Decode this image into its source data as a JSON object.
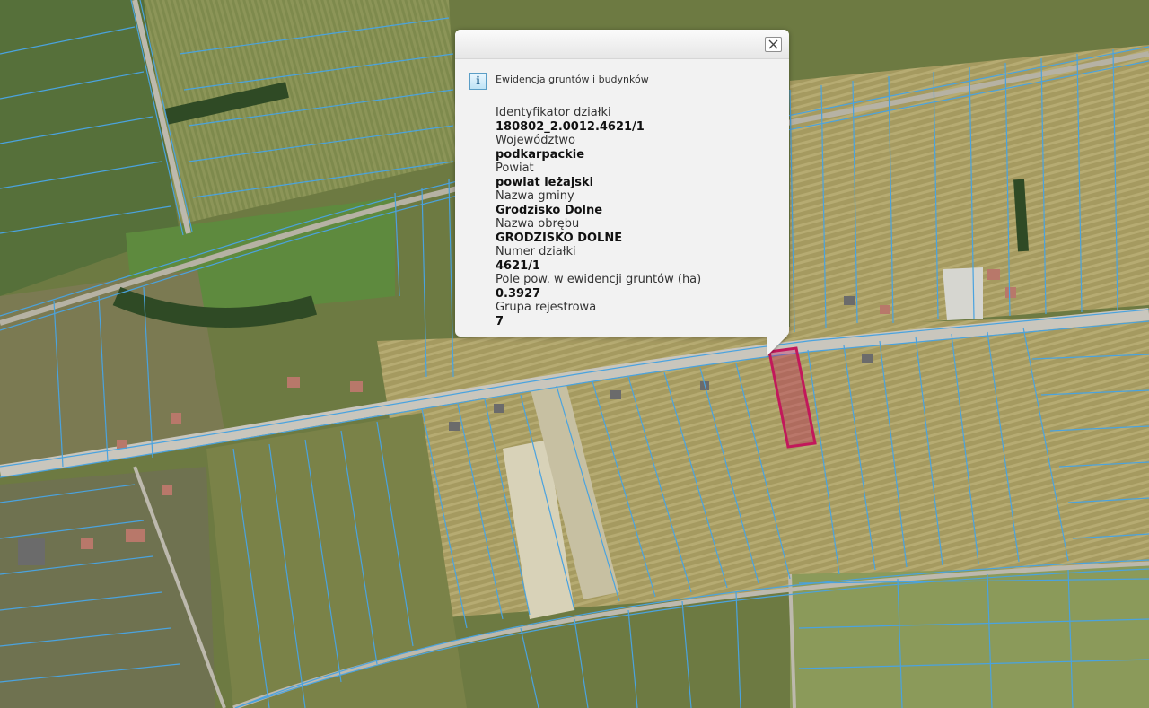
{
  "map": {
    "highlight_color": "#c2185b",
    "parcel_line_color": "#4aa3df"
  },
  "popup": {
    "title": "Ewidencja gruntów i budynków",
    "close_icon": "close-icon",
    "info_icon": "info-icon",
    "info_glyph": "i",
    "fields": [
      {
        "label": "Identyfikator działki",
        "value": "180802_2.0012.4621/1"
      },
      {
        "label": "Województwo",
        "value": "podkarpackie"
      },
      {
        "label": "Powiat",
        "value": "powiat leżajski"
      },
      {
        "label": "Nazwa gminy",
        "value": "Grodzisko Dolne"
      },
      {
        "label": "Nazwa obrębu",
        "value": "GRODZISKO DOLNE"
      },
      {
        "label": "Numer działki",
        "value": "4621/1"
      },
      {
        "label": "Pole pow. w ewidencji gruntów (ha)",
        "value": "0.3927"
      },
      {
        "label": "Grupa rejestrowa",
        "value": "7"
      }
    ]
  }
}
